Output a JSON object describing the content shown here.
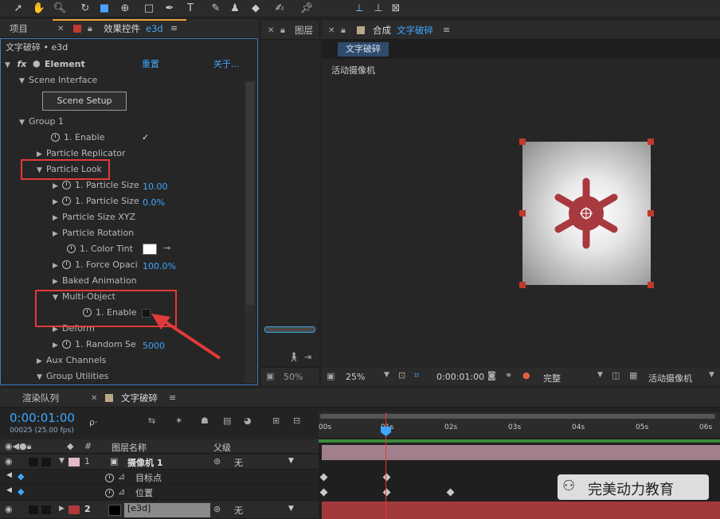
{
  "toolbar": {
    "icons": [
      "selection-icon",
      "hand-icon",
      "zoom-icon",
      "rotate-icon",
      "camera-icon",
      "pan-behind-icon",
      "rectangle-icon",
      "pen-icon",
      "text-icon",
      "brush-icon",
      "clone-stamp-icon",
      "eraser-icon",
      "roto-brush-icon",
      "pin-icon",
      "axis-local-icon",
      "axis-world-icon",
      "axis-view-icon"
    ]
  },
  "left_panel": {
    "tab_project": "项目",
    "tab_effects": "效果控件",
    "tab_effects_suffix": "e3d",
    "breadcrumb": "文字破碎 • e3d",
    "effect_name": "Element",
    "reset": "重置",
    "about": "关于...",
    "scene_interface": "Scene Interface",
    "scene_setup": "Scene Setup",
    "group1": "Group 1",
    "enable1": "1. Enable",
    "enable1_check": "✓",
    "particle_replicator": "Particle Replicator",
    "particle_look": "Particle Look",
    "particle_size": "1. Particle Size",
    "particle_size_val": "10.00",
    "particle_size_pct": "1. Particle Size",
    "particle_size_pct_val": "0.0%",
    "particle_size_xyz": "Particle Size XYZ",
    "particle_rotation": "Particle Rotation",
    "color_tint": "1. Color Tint",
    "force_opacity": "1. Force Opaci",
    "force_opacity_val": "100.0%",
    "baked_animation": "Baked Animation",
    "multi_object": "Multi-Object",
    "mo_enable": "1. Enable",
    "deform": "Deform",
    "random_seed": "1. Random Se",
    "random_seed_val": "5000",
    "aux_channels": "Aux Channels",
    "group_utilities": "Group Utilities"
  },
  "layer_panel": {
    "tab": "图层",
    "zoom": "50%"
  },
  "comp_panel": {
    "tab": "合成",
    "comp_name": "文字破碎",
    "comp_chip": "文字破碎",
    "view_label": "活动摄像机",
    "zoom": "25%",
    "timecode": "0:00:01:00",
    "quality": "完整",
    "camera": "活动摄像机"
  },
  "timeline": {
    "tab_render": "渲染队列",
    "tab_comp": "文字破碎",
    "timecode": "0:00:01:00",
    "frame_info": "00025 (25.00 fps)",
    "col_num": "#",
    "col_layer_name": "图层名称",
    "col_parent": "父级",
    "ruler": [
      "00s",
      "01s",
      "02s",
      "03s",
      "04s",
      "05s",
      "06s"
    ],
    "layers": [
      {
        "num": "1",
        "name": "摄像机 1",
        "parent": "无"
      },
      {
        "prop": "目标点"
      },
      {
        "prop": "位置"
      },
      {
        "num": "2",
        "name": "[e3d]",
        "parent": "无"
      }
    ]
  },
  "watermark": "完美动力教育",
  "colors": {
    "accent_blue": "#3fa6ff",
    "highlight_red": "#e23a3a",
    "asterisk": "#a83a3f"
  }
}
